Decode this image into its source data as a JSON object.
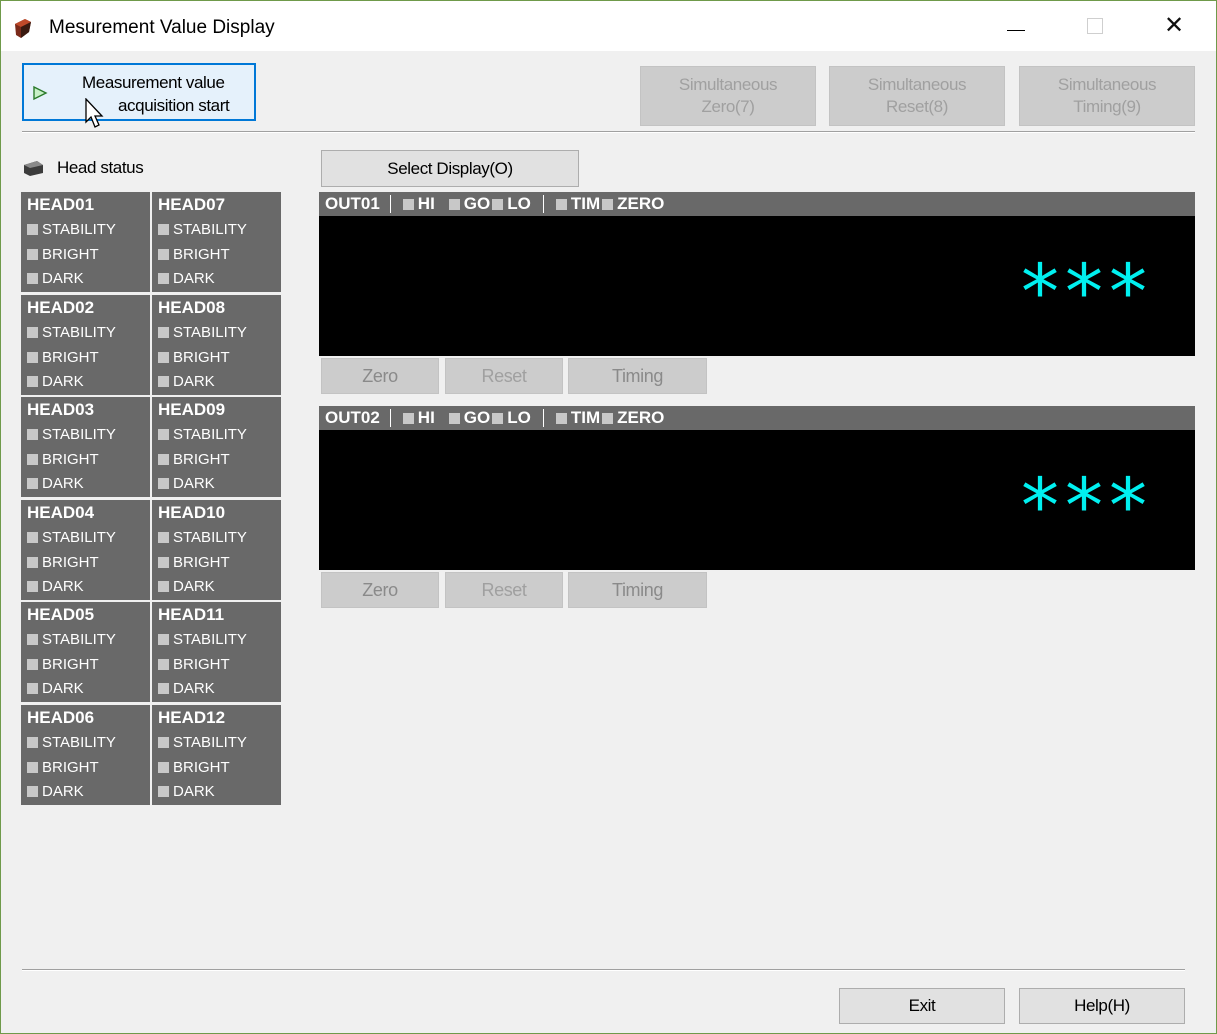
{
  "window": {
    "title": "Mesurement Value Display",
    "buttons": {
      "minimize": "—",
      "maximize": "☐",
      "close": "✕"
    }
  },
  "toolbar": {
    "start_line1": "Measurement value",
    "start_line2": "acquisition start",
    "sim_zero": [
      "Simultaneous",
      "Zero(7)"
    ],
    "sim_reset": [
      "Simultaneous",
      "Reset(8)"
    ],
    "sim_timing": [
      "Simultaneous",
      "Timing(9)"
    ]
  },
  "head_status": {
    "label": "Head status",
    "flag_labels": [
      "STABILITY",
      "BRIGHT",
      "DARK"
    ],
    "heads": [
      "HEAD01",
      "HEAD02",
      "HEAD03",
      "HEAD04",
      "HEAD05",
      "HEAD06",
      "HEAD07",
      "HEAD08",
      "HEAD09",
      "HEAD10",
      "HEAD11",
      "HEAD12"
    ]
  },
  "select_display_label": "Select Display(O)",
  "outputs": [
    {
      "name": "OUT01",
      "indicators": [
        "HI",
        "GO",
        "LO",
        "TIM",
        "ZERO"
      ],
      "value": "***",
      "buttons": {
        "zero": "Zero",
        "reset": "Reset",
        "timing": "Timing"
      }
    },
    {
      "name": "OUT02",
      "indicators": [
        "HI",
        "GO",
        "LO",
        "TIM",
        "ZERO"
      ],
      "value": "***",
      "buttons": {
        "zero": "Zero",
        "reset": "Reset",
        "timing": "Timing"
      }
    }
  ],
  "footer": {
    "exit": "Exit",
    "help": "Help(H)"
  },
  "colors": {
    "value_text": "#00f0f0",
    "panel_gray": "#696969",
    "display_bg": "#000000",
    "focus_border": "#0078d7"
  }
}
